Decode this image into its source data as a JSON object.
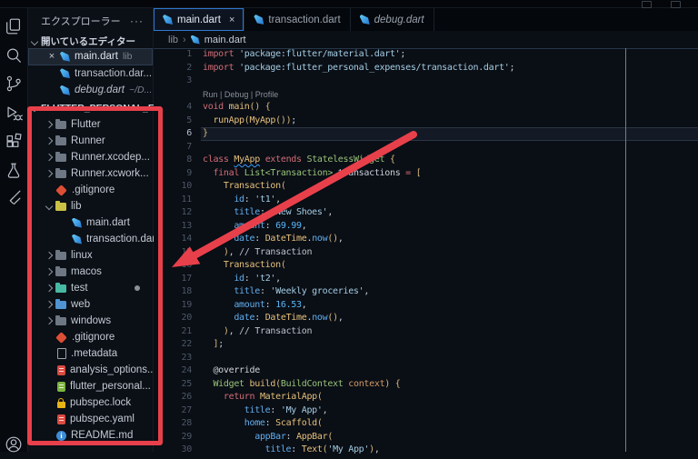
{
  "glyphs": {
    "close": "×",
    "more": "···",
    "crumb_sep": "›"
  },
  "colors": {
    "annotation_red": "#e8404b",
    "active_tab_outline": "#2f78cc",
    "keyword": "#d16d76",
    "type_green": "#98c379",
    "function_yellow": "#e5c07b",
    "property_blue": "#61afef",
    "string_blue": "#a3cde4",
    "dart_icon_blue": "#42a0e4"
  },
  "activity_bar": {
    "icons": [
      "explorer-icon",
      "search-icon",
      "source-control-icon",
      "run-debug-icon",
      "extensions-icon",
      "test-beaker-icon",
      "flutter-icon",
      "account-icon"
    ]
  },
  "sidebar": {
    "title": "エクスプローラー",
    "open_editors_header": "開いているエディター",
    "open_editors": [
      {
        "name": "main.dart",
        "suffix": "lib",
        "active": true
      },
      {
        "name": "transaction.dar...",
        "suffix": "",
        "active": false
      },
      {
        "name": "debug.dart",
        "suffix": "~/D...",
        "active": false,
        "italic": true
      }
    ],
    "project_header": "FLUTTER_PERSONAL_E...",
    "tree": [
      {
        "icon": "folder",
        "chev": "r",
        "depth": 0,
        "label": "Flutter"
      },
      {
        "icon": "folder",
        "chev": "r",
        "depth": 0,
        "label": "Runner"
      },
      {
        "icon": "folder",
        "chev": "r",
        "depth": 0,
        "label": "Runner.xcodep..."
      },
      {
        "icon": "folder",
        "chev": "r",
        "depth": 0,
        "label": "Runner.xcwork..."
      },
      {
        "icon": "git",
        "chev": "",
        "depth": 0,
        "label": ".gitignore"
      },
      {
        "icon": "folder-lib",
        "chev": "d",
        "depth": 0,
        "label": "lib"
      },
      {
        "icon": "dart",
        "chev": "",
        "depth": 1,
        "label": "main.dart"
      },
      {
        "icon": "dart",
        "chev": "",
        "depth": 1,
        "label": "transaction.dart"
      },
      {
        "icon": "folder",
        "chev": "r",
        "depth": 0,
        "label": "linux"
      },
      {
        "icon": "folder",
        "chev": "r",
        "depth": 0,
        "label": "macos"
      },
      {
        "icon": "folder-test",
        "chev": "r",
        "depth": 0,
        "label": "test",
        "badge": true
      },
      {
        "icon": "folder-web",
        "chev": "r",
        "depth": 0,
        "label": "web"
      },
      {
        "icon": "folder",
        "chev": "r",
        "depth": 0,
        "label": "windows"
      },
      {
        "icon": "git",
        "chev": "",
        "depth": 0,
        "label": ".gitignore"
      },
      {
        "icon": "file",
        "chev": "",
        "depth": 0,
        "label": ".metadata"
      },
      {
        "icon": "yaml",
        "chev": "",
        "depth": 0,
        "label": "analysis_options..."
      },
      {
        "icon": "iml",
        "chev": "",
        "depth": 0,
        "label": "flutter_personal..."
      },
      {
        "icon": "lock",
        "chev": "",
        "depth": 0,
        "label": "pubspec.lock"
      },
      {
        "icon": "yaml",
        "chev": "",
        "depth": 0,
        "label": "pubspec.yaml"
      },
      {
        "icon": "info",
        "chev": "",
        "depth": 0,
        "label": "README.md"
      }
    ]
  },
  "tabs": [
    {
      "label": "main.dart",
      "active": true,
      "closable": true
    },
    {
      "label": "transaction.dart",
      "active": false
    },
    {
      "label": "debug.dart",
      "active": false,
      "italic": true
    }
  ],
  "breadcrumb": {
    "folder": "lib",
    "file": "main.dart"
  },
  "editor": {
    "cursor_line": 6,
    "code_lens": "Run | Debug | Profile",
    "lines": [
      {
        "n": 1,
        "t": [
          [
            "k",
            "import"
          ],
          [
            "w",
            " "
          ],
          [
            "s",
            "'package:flutter/material.dart'"
          ],
          [
            "p",
            ";"
          ]
        ]
      },
      {
        "n": 2,
        "t": [
          [
            "k",
            "import"
          ],
          [
            "w",
            " "
          ],
          [
            "s",
            "'package:flutter_personal_expenses/transaction.dart'"
          ],
          [
            "p",
            ";"
          ]
        ]
      },
      {
        "n": 3,
        "t": []
      },
      {
        "lens": true
      },
      {
        "n": 4,
        "t": [
          [
            "k",
            "void"
          ],
          [
            "w",
            " "
          ],
          [
            "f",
            "main"
          ],
          [
            "b",
            "()"
          ],
          [
            "w",
            " "
          ],
          [
            "b",
            "{"
          ]
        ]
      },
      {
        "n": 5,
        "t": [
          [
            "w",
            "  "
          ],
          [
            "f",
            "runApp"
          ],
          [
            "b",
            "("
          ],
          [
            "f",
            "MyApp"
          ],
          [
            "b",
            "())"
          ],
          [
            "p",
            ";"
          ]
        ]
      },
      {
        "n": 6,
        "t": [
          [
            "b",
            "}"
          ]
        ]
      },
      {
        "n": 7,
        "t": []
      },
      {
        "n": 8,
        "t": [
          [
            "k",
            "class"
          ],
          [
            "w",
            " "
          ],
          [
            "fq",
            "MyApp"
          ],
          [
            "w",
            " "
          ],
          [
            "k",
            "extends"
          ],
          [
            "w",
            " "
          ],
          [
            "y",
            "StatelessWidget"
          ],
          [
            "w",
            " "
          ],
          [
            "b",
            "{"
          ]
        ]
      },
      {
        "n": 9,
        "t": [
          [
            "w",
            "  "
          ],
          [
            "k",
            "final"
          ],
          [
            "w",
            " "
          ],
          [
            "y",
            "List<Transaction>"
          ],
          [
            "w",
            " "
          ],
          [
            "w",
            "transactions"
          ],
          [
            "w",
            " "
          ],
          [
            "k",
            "="
          ],
          [
            "w",
            " "
          ],
          [
            "b",
            "["
          ]
        ]
      },
      {
        "n": 10,
        "t": [
          [
            "w",
            "    "
          ],
          [
            "f",
            "Transaction"
          ],
          [
            "b",
            "("
          ]
        ]
      },
      {
        "n": 11,
        "t": [
          [
            "w",
            "      "
          ],
          [
            "o",
            "id"
          ],
          [
            "p",
            ":"
          ],
          [
            "w",
            " "
          ],
          [
            "s",
            "'t1'"
          ],
          [
            "p",
            ","
          ]
        ]
      },
      {
        "n": 12,
        "t": [
          [
            "w",
            "      "
          ],
          [
            "o",
            "title"
          ],
          [
            "p",
            ":"
          ],
          [
            "w",
            " "
          ],
          [
            "s",
            "'New Shoes'"
          ],
          [
            "p",
            ","
          ]
        ]
      },
      {
        "n": 13,
        "t": [
          [
            "w",
            "      "
          ],
          [
            "o",
            "amount"
          ],
          [
            "p",
            ":"
          ],
          [
            "w",
            " "
          ],
          [
            "n",
            "69.99"
          ],
          [
            "p",
            ","
          ]
        ]
      },
      {
        "n": 14,
        "t": [
          [
            "w",
            "      "
          ],
          [
            "o",
            "date"
          ],
          [
            "p",
            ":"
          ],
          [
            "w",
            " "
          ],
          [
            "f",
            "DateTime"
          ],
          [
            "p",
            "."
          ],
          [
            "o",
            "now"
          ],
          [
            "b",
            "()"
          ],
          [
            "p",
            ","
          ]
        ]
      },
      {
        "n": 15,
        "t": [
          [
            "w",
            "    "
          ],
          [
            "b",
            ")"
          ],
          [
            "p",
            ","
          ],
          [
            "w",
            " "
          ],
          [
            "c",
            "// Transaction"
          ]
        ]
      },
      {
        "n": 16,
        "t": [
          [
            "w",
            "    "
          ],
          [
            "f",
            "Transaction"
          ],
          [
            "b",
            "("
          ]
        ]
      },
      {
        "n": 17,
        "t": [
          [
            "w",
            "      "
          ],
          [
            "o",
            "id"
          ],
          [
            "p",
            ":"
          ],
          [
            "w",
            " "
          ],
          [
            "s",
            "'t2'"
          ],
          [
            "p",
            ","
          ]
        ]
      },
      {
        "n": 18,
        "t": [
          [
            "w",
            "      "
          ],
          [
            "o",
            "title"
          ],
          [
            "p",
            ":"
          ],
          [
            "w",
            " "
          ],
          [
            "s",
            "'Weekly groceries'"
          ],
          [
            "p",
            ","
          ]
        ]
      },
      {
        "n": 19,
        "t": [
          [
            "w",
            "      "
          ],
          [
            "o",
            "amount"
          ],
          [
            "p",
            ":"
          ],
          [
            "w",
            " "
          ],
          [
            "n",
            "16.53"
          ],
          [
            "p",
            ","
          ]
        ]
      },
      {
        "n": 20,
        "t": [
          [
            "w",
            "      "
          ],
          [
            "o",
            "date"
          ],
          [
            "p",
            ":"
          ],
          [
            "w",
            " "
          ],
          [
            "f",
            "DateTime"
          ],
          [
            "p",
            "."
          ],
          [
            "o",
            "now"
          ],
          [
            "b",
            "()"
          ],
          [
            "p",
            ","
          ]
        ]
      },
      {
        "n": 21,
        "t": [
          [
            "w",
            "    "
          ],
          [
            "b",
            ")"
          ],
          [
            "p",
            ","
          ],
          [
            "w",
            " "
          ],
          [
            "c",
            "// Transaction"
          ]
        ]
      },
      {
        "n": 22,
        "t": [
          [
            "w",
            "  "
          ],
          [
            "b",
            "]"
          ],
          [
            "p",
            ";"
          ]
        ]
      },
      {
        "n": 23,
        "t": []
      },
      {
        "n": 24,
        "t": [
          [
            "w",
            "  "
          ],
          [
            "a",
            "@override"
          ]
        ]
      },
      {
        "n": 25,
        "t": [
          [
            "w",
            "  "
          ],
          [
            "y",
            "Widget"
          ],
          [
            "w",
            " "
          ],
          [
            "f",
            "build"
          ],
          [
            "b",
            "("
          ],
          [
            "y",
            "BuildContext"
          ],
          [
            "w",
            " "
          ],
          [
            "g",
            "context"
          ],
          [
            "b",
            ")"
          ],
          [
            "w",
            " "
          ],
          [
            "b",
            "{"
          ]
        ]
      },
      {
        "n": 26,
        "t": [
          [
            "w",
            "    "
          ],
          [
            "k",
            "return"
          ],
          [
            "w",
            " "
          ],
          [
            "f",
            "MaterialApp"
          ],
          [
            "b",
            "("
          ]
        ]
      },
      {
        "n": 27,
        "t": [
          [
            "w",
            "        "
          ],
          [
            "o",
            "title"
          ],
          [
            "p",
            ":"
          ],
          [
            "w",
            " "
          ],
          [
            "s",
            "'My App'"
          ],
          [
            "p",
            ","
          ]
        ]
      },
      {
        "n": 28,
        "t": [
          [
            "w",
            "        "
          ],
          [
            "o",
            "home"
          ],
          [
            "p",
            ":"
          ],
          [
            "w",
            " "
          ],
          [
            "f",
            "Scaffold"
          ],
          [
            "b",
            "("
          ]
        ]
      },
      {
        "n": 29,
        "t": [
          [
            "w",
            "          "
          ],
          [
            "o",
            "appBar"
          ],
          [
            "p",
            ":"
          ],
          [
            "w",
            " "
          ],
          [
            "f",
            "AppBar"
          ],
          [
            "b",
            "("
          ]
        ]
      },
      {
        "n": 30,
        "t": [
          [
            "w",
            "            "
          ],
          [
            "o",
            "title"
          ],
          [
            "p",
            ":"
          ],
          [
            "w",
            " "
          ],
          [
            "f",
            "Text"
          ],
          [
            "b",
            "("
          ],
          [
            "s",
            "'My App'"
          ],
          [
            "b",
            ")"
          ],
          [
            "p",
            ","
          ]
        ]
      }
    ]
  },
  "annotations": {
    "color": "#e8404b",
    "shapes": [
      "highlight-box-around-file-tree",
      "arrow-pointing-to-file-tree"
    ]
  }
}
